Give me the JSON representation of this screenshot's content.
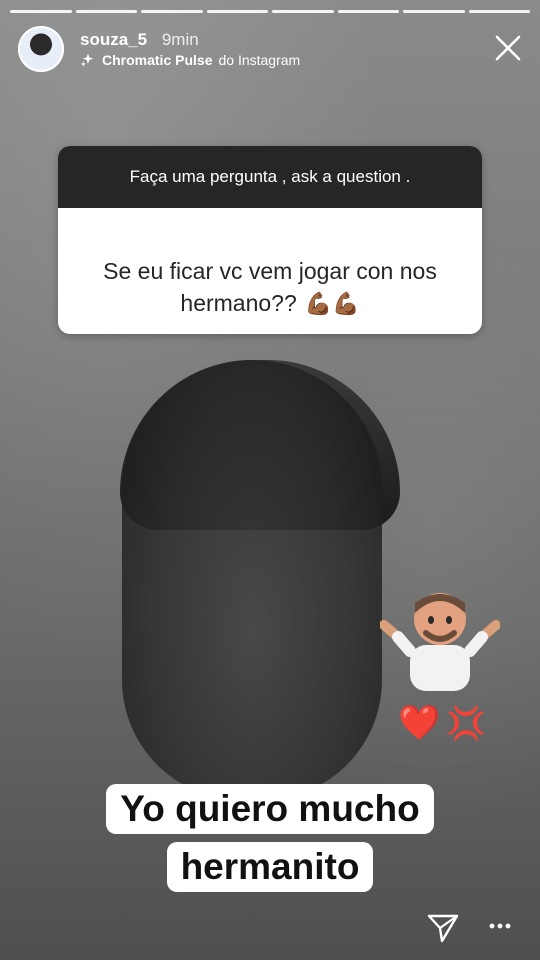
{
  "story": {
    "segments_count": 8,
    "username": "souza_5",
    "time_ago": "9min",
    "filter_name": "Chromatic Pulse",
    "filter_source": "do Instagram"
  },
  "question": {
    "prompt": "Faça uma pergunta , ask a question .",
    "answer": "Se eu ficar vc vem jogar con nos\nhermano??",
    "emoji": "💪🏾💪🏾"
  },
  "caption": {
    "line1": "Yo quiero mucho",
    "line2": "hermanito"
  },
  "stickers": {
    "heart": "❤️",
    "anger": "💢"
  },
  "icons": {
    "close": "close-icon",
    "send": "send-icon",
    "more": "more-icon",
    "filter": "sparkles-icon"
  },
  "colors": {
    "dark": "#262626",
    "white": "#ffffff"
  }
}
